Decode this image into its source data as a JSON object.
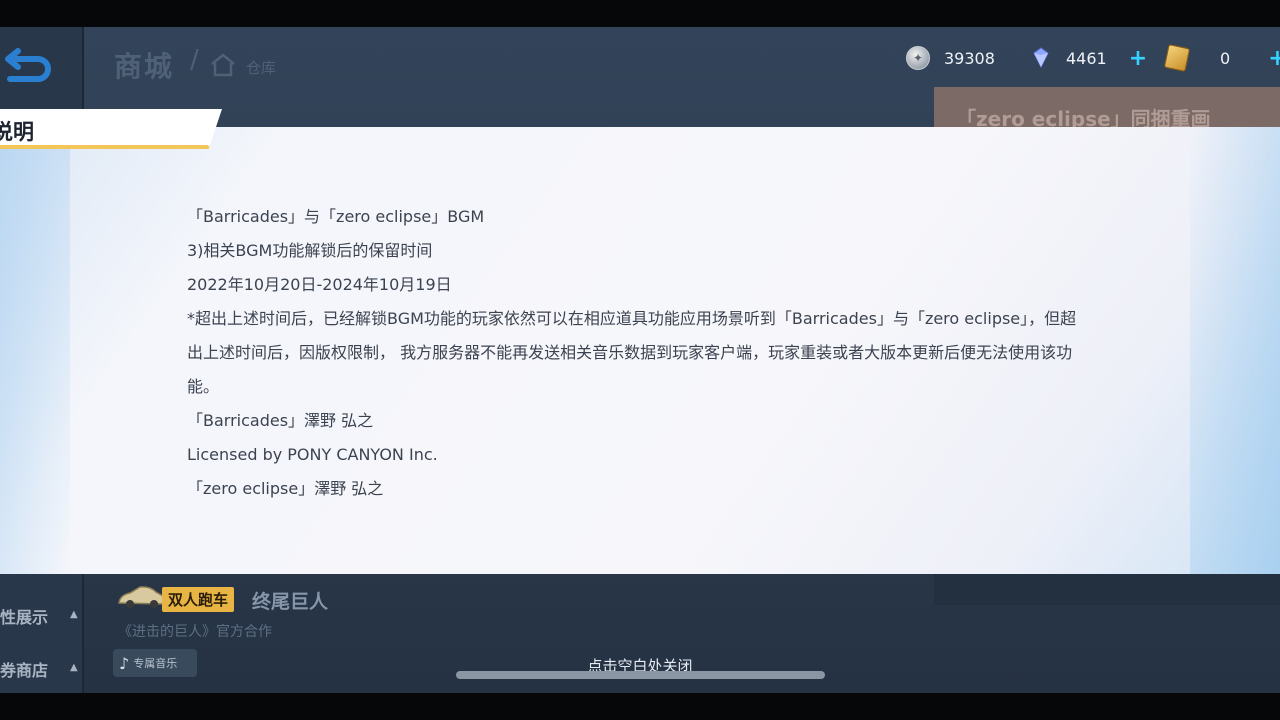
{
  "header": {
    "title": "商城",
    "separator": "/",
    "breadcrumb": "仓库"
  },
  "currencies": {
    "coins": "39308",
    "gems": "4461",
    "tickets": "0"
  },
  "preview": {
    "title": "「zero eclipse」同捆重画"
  },
  "dialog": {
    "tab_label": "说明",
    "lines": [
      "「Barricades」与「zero eclipse」BGM",
      "3)相关BGM功能解锁后的保留时间",
      "2022年10月20日-2024年10月19日",
      "*超出上述时间后，已经解锁BGM功能的玩家依然可以在相应道具功能应用场景听到「Barricades」与「zero eclipse」，但超出上述时间后，因版权限制， 我方服务器不能再发送相关音乐数据到玩家客户端，玩家重装或者大版本更新后便无法使用该功能。",
      "「Barricades」澤野 弘之",
      "Licensed by PONY CANYON Inc.",
      "「zero eclipse」澤野 弘之"
    ]
  },
  "menu": {
    "item1": "性展示",
    "item2": "券商店"
  },
  "promo": {
    "tag": "双人跑车",
    "name": "终尾巨人",
    "subtitle": "《进击的巨人》官方合作",
    "music_chip": "专属音乐"
  },
  "close_hint": "点击空白处关闭",
  "icons": [
    "back-arrow-icon",
    "house-icon",
    "coin-icon",
    "gem-icon",
    "ticket-icon",
    "plus-icon",
    "car-icon",
    "music-note-icon"
  ],
  "colors": {
    "accent": "#f3c65a",
    "plus": "#35d3ff"
  }
}
